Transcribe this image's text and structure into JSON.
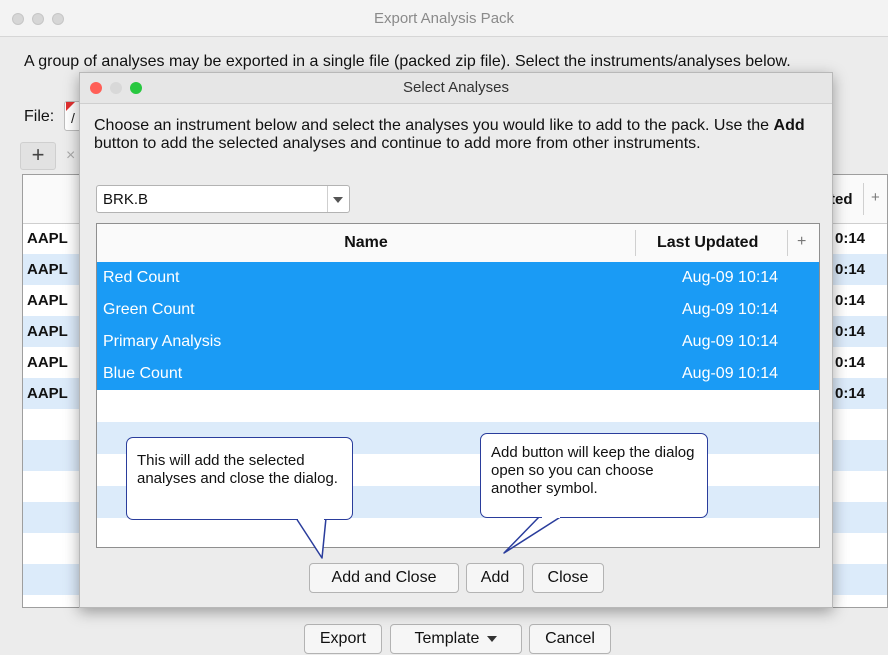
{
  "window": {
    "title": "Export Analysis Pack"
  },
  "description": "A group of analyses may be exported in a single file (packed zip file). Select the instruments/analyses below.",
  "file_label": "File:",
  "file_partial_text": "/",
  "toolbar": {
    "add_label": "+",
    "remove_label": "×"
  },
  "outer_table": {
    "visible_header": "ted",
    "header_plus": "+",
    "rows": [
      {
        "symbol": "AAPL",
        "time": "0:14"
      },
      {
        "symbol": "AAPL",
        "time": "0:14"
      },
      {
        "symbol": "AAPL",
        "time": "0:14"
      },
      {
        "symbol": "AAPL",
        "time": "0:14"
      },
      {
        "symbol": "AAPL",
        "time": "0:14"
      },
      {
        "symbol": "AAPL",
        "time": "0:14"
      }
    ]
  },
  "bottom_buttons": {
    "export": "Export",
    "template": "Template",
    "cancel": "Cancel"
  },
  "dialog": {
    "title": "Select Analyses",
    "instructions_part1": "Choose an instrument below and select the analyses you would like to add to the pack.  Use the ",
    "instructions_bold": "Add",
    "instructions_part2": " button to add the selected analyses and continue to add more from other instruments.",
    "instrument": "BRK.B",
    "table": {
      "col_name": "Name",
      "col_updated": "Last Updated",
      "col_plus": "+",
      "rows": [
        {
          "name": "Red Count",
          "updated": "Aug-09 10:14"
        },
        {
          "name": "Green Count",
          "updated": "Aug-09 10:14"
        },
        {
          "name": "Primary Analysis",
          "updated": "Aug-09 10:14"
        },
        {
          "name": "Blue Count",
          "updated": "Aug-09 10:14"
        }
      ]
    },
    "buttons": {
      "add_close": "Add and Close",
      "add": "Add",
      "close": "Close"
    }
  },
  "callouts": {
    "left": "This will add the selected analyses and close the dialog.",
    "right": "Add button will keep the dialog open so you can choose another symbol."
  },
  "colors": {
    "selection": "#1a9bf5",
    "alt_row": "#dcebfa",
    "callout_border": "#2a3d9c",
    "traffic_red": "#ff5f57",
    "traffic_yellow": "#febc2e",
    "traffic_green": "#28c840"
  }
}
